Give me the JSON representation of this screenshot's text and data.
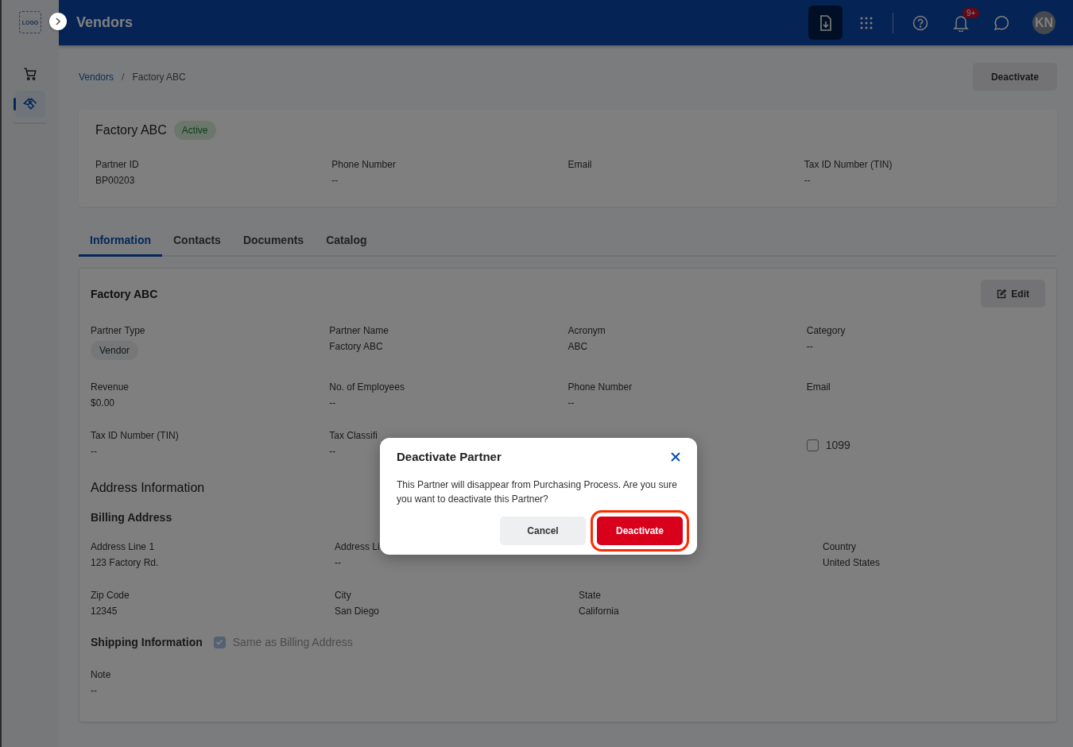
{
  "sidebar": {
    "logo": "LOGO",
    "items": [
      {
        "kind": "cart",
        "selected": false
      },
      {
        "kind": "partners",
        "selected": true
      }
    ]
  },
  "header": {
    "title": "Vendors",
    "actions": [
      {
        "kind": "download",
        "selected": true
      },
      {
        "kind": "apps",
        "selected": false
      },
      {
        "kind": "divider"
      },
      {
        "kind": "help",
        "selected": false
      },
      {
        "kind": "bell",
        "selected": false,
        "badge": "9+"
      },
      {
        "kind": "chat",
        "selected": false
      }
    ],
    "avatar": "KN"
  },
  "breadcrumb": [
    {
      "label": "Vendors",
      "link": true
    },
    {
      "separator": "/",
      "label": "Factory ABC",
      "link": false
    }
  ],
  "page_action": "Deactivate",
  "summary": {
    "name": "Factory ABC",
    "status": "Active",
    "fields": [
      {
        "label": "Partner ID",
        "value": "BP00203"
      },
      {
        "label": "Phone Number",
        "value": "--"
      },
      {
        "label": "Email"
      },
      {
        "label": "Tax ID Number (TIN)",
        "value": "--"
      }
    ]
  },
  "tabs": [
    {
      "label": "Information",
      "selected": true
    },
    {
      "label": "Contacts",
      "selected": false
    },
    {
      "label": "Documents",
      "selected": false
    },
    {
      "label": "Catalog",
      "selected": false
    }
  ],
  "info": {
    "title": "Factory ABC",
    "edit": "Edit",
    "rows": [
      [
        {
          "kind": "chip",
          "label": "Partner Type",
          "value": "Vendor"
        },
        {
          "kind": "field",
          "label": "Partner Name",
          "value": "Factory ABC"
        },
        {
          "kind": "field",
          "label": "Acronym",
          "value": "ABC"
        },
        {
          "kind": "field",
          "label": "Category",
          "value": "--"
        }
      ],
      [
        {
          "kind": "field",
          "label": "Revenue",
          "value": "$0.00"
        },
        {
          "kind": "field",
          "label": "No. of Employees",
          "value": "--"
        },
        {
          "kind": "field",
          "label": "Phone Number",
          "value": "--"
        },
        {
          "kind": "field",
          "label": "Email"
        }
      ],
      [
        {
          "kind": "field",
          "label": "Tax ID Number (TIN)",
          "value": "--"
        },
        {
          "kind": "field",
          "label": "Tax Classifi",
          "value": "--"
        },
        {
          "kind": "checkbox",
          "label": "1099",
          "checked": false
        }
      ]
    ],
    "address_title": "Address Information",
    "billing_title": "Billing Address",
    "address_rows": [
      [
        {
          "label": "Address Line 1",
          "value": "123 Factory Rd."
        },
        {
          "label": "Address Li",
          "value": "--"
        },
        {
          "label": "Country",
          "value": "United States"
        }
      ],
      [
        {
          "label": "Zip Code",
          "value": "12345"
        },
        {
          "label": "City",
          "value": "San Diego"
        },
        {
          "label": "State",
          "value": "California"
        }
      ]
    ],
    "shipping": {
      "title": "Shipping Information",
      "label": "Same as Billing Address",
      "checked": true
    },
    "note": {
      "label": "Note",
      "value": "--"
    }
  },
  "dialog": {
    "title": "Deactivate Partner",
    "message": "This Partner will disappear from Purchasing Process. Are you sure you want to deactivate this Partner?",
    "buttons": [
      {
        "kind": "secondary",
        "label": "Cancel",
        "highlighted": false
      },
      {
        "kind": "danger",
        "label": "Deactivate",
        "highlighted": true
      }
    ]
  }
}
